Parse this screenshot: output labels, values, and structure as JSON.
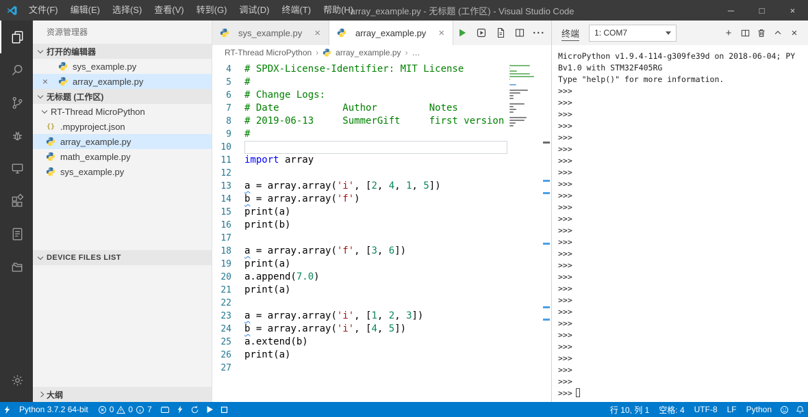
{
  "window": {
    "title": "array_example.py - 无标题 (工作区) - Visual Studio Code",
    "menus": [
      "文件(F)",
      "编辑(E)",
      "选择(S)",
      "查看(V)",
      "转到(G)",
      "调试(D)",
      "终端(T)",
      "帮助(H)"
    ],
    "controls": {
      "minimize": "─",
      "maximize": "□",
      "close": "×"
    }
  },
  "icons": {
    "more_actions": "···",
    "breadcrumb_separator": "›",
    "tab_close": "×",
    "close_glyph": "×",
    "plus": "+",
    "json_glyph": "{}"
  },
  "activity_bar": {
    "items": [
      "explorer",
      "search",
      "source-control",
      "debug",
      "device",
      "extensions",
      "notes",
      "folders"
    ],
    "bottom_item": "settings"
  },
  "sidebar": {
    "title": "资源管理器",
    "open_editors": {
      "header": "打开的编辑器",
      "items": [
        {
          "label": "sys_example.py",
          "selected": false
        },
        {
          "label": "array_example.py",
          "selected": true
        }
      ]
    },
    "workspace": {
      "header": "无标题 (工作区)",
      "folder": "RT-Thread MicroPython",
      "files": [
        {
          "label": ".mpyproject.json",
          "icon": "json",
          "selected": false
        },
        {
          "label": "array_example.py",
          "icon": "python",
          "selected": true
        },
        {
          "label": "math_example.py",
          "icon": "python",
          "selected": false
        },
        {
          "label": "sys_example.py",
          "icon": "python",
          "selected": false
        }
      ]
    },
    "device_files_header": "DEVICE FILES LIST",
    "outline_header": "大纲"
  },
  "editor": {
    "tabs": [
      {
        "label": "sys_example.py",
        "active": false
      },
      {
        "label": "array_example.py",
        "active": true
      }
    ],
    "breadcrumbs": [
      "RT-Thread MicroPython",
      "array_example.py",
      "…"
    ],
    "current_line": 10,
    "lines": [
      {
        "n": 4,
        "t": [
          [
            "c",
            "# SPDX-License-Identifier: MIT License"
          ]
        ]
      },
      {
        "n": 5,
        "t": [
          [
            "c",
            "#"
          ]
        ]
      },
      {
        "n": 6,
        "t": [
          [
            "c",
            "# Change Logs:"
          ]
        ]
      },
      {
        "n": 7,
        "t": [
          [
            "c",
            "# Date           Author         Notes"
          ]
        ]
      },
      {
        "n": 8,
        "t": [
          [
            "c",
            "# 2019-06-13     SummerGift     first version"
          ]
        ]
      },
      {
        "n": 9,
        "t": [
          [
            "c",
            "#"
          ]
        ]
      },
      {
        "n": 10,
        "t": []
      },
      {
        "n": 11,
        "t": [
          [
            "k",
            "import"
          ],
          [
            "d",
            " array"
          ]
        ]
      },
      {
        "n": 12,
        "t": []
      },
      {
        "n": 13,
        "t": [
          [
            "du",
            "a"
          ],
          [
            "d",
            " = array.array("
          ],
          [
            "s",
            "'i'"
          ],
          [
            "d",
            ", ["
          ],
          [
            "n",
            "2"
          ],
          [
            "d",
            ", "
          ],
          [
            "n",
            "4"
          ],
          [
            "d",
            ", "
          ],
          [
            "n",
            "1"
          ],
          [
            "d",
            ", "
          ],
          [
            "n",
            "5"
          ],
          [
            "d",
            "])"
          ]
        ]
      },
      {
        "n": 14,
        "t": [
          [
            "du",
            "b"
          ],
          [
            "d",
            " = array.array("
          ],
          [
            "s",
            "'f'"
          ],
          [
            "d",
            ")"
          ]
        ]
      },
      {
        "n": 15,
        "t": [
          [
            "d",
            "print(a)"
          ]
        ]
      },
      {
        "n": 16,
        "t": [
          [
            "d",
            "print(b)"
          ]
        ]
      },
      {
        "n": 17,
        "t": []
      },
      {
        "n": 18,
        "t": [
          [
            "du",
            "a"
          ],
          [
            "d",
            " = array.array("
          ],
          [
            "s",
            "'f'"
          ],
          [
            "d",
            ", ["
          ],
          [
            "n",
            "3"
          ],
          [
            "d",
            ", "
          ],
          [
            "n",
            "6"
          ],
          [
            "d",
            "])"
          ]
        ]
      },
      {
        "n": 19,
        "t": [
          [
            "d",
            "print(a)"
          ]
        ]
      },
      {
        "n": 20,
        "t": [
          [
            "d",
            "a.append("
          ],
          [
            "n",
            "7.0"
          ],
          [
            "d",
            ")"
          ]
        ]
      },
      {
        "n": 21,
        "t": [
          [
            "d",
            "print(a)"
          ]
        ]
      },
      {
        "n": 22,
        "t": []
      },
      {
        "n": 23,
        "t": [
          [
            "du",
            "a"
          ],
          [
            "d",
            " = array.array("
          ],
          [
            "s",
            "'i'"
          ],
          [
            "d",
            ", ["
          ],
          [
            "n",
            "1"
          ],
          [
            "d",
            ", "
          ],
          [
            "n",
            "2"
          ],
          [
            "d",
            ", "
          ],
          [
            "n",
            "3"
          ],
          [
            "d",
            "])"
          ]
        ]
      },
      {
        "n": 24,
        "t": [
          [
            "du",
            "b"
          ],
          [
            "d",
            " = array.array("
          ],
          [
            "s",
            "'i'"
          ],
          [
            "d",
            ", ["
          ],
          [
            "n",
            "4"
          ],
          [
            "d",
            ", "
          ],
          [
            "n",
            "5"
          ],
          [
            "d",
            "])"
          ]
        ]
      },
      {
        "n": 25,
        "t": [
          [
            "d",
            "a.extend(b)"
          ]
        ]
      },
      {
        "n": 26,
        "t": [
          [
            "d",
            "print(a)"
          ]
        ]
      },
      {
        "n": 27,
        "t": []
      }
    ]
  },
  "terminal": {
    "title": "终端",
    "selected_device": "1: COM7",
    "intro_lines": [
      "MicroPython v1.9.4-114-g309fe39d on 2018-06-04; PY",
      "Bv1.0 with STM32F405RG",
      "Type \"help()\" for more information."
    ],
    "prompt": ">>>",
    "prompt_count": 27
  },
  "status_bar": {
    "interpreter": "Python 3.7.2 64-bit",
    "errors": "0",
    "warnings": "0",
    "infos": "7",
    "line_col": "行 10, 列 1",
    "indent": "空格: 4",
    "encoding": "UTF-8",
    "eol": "LF",
    "language": "Python"
  },
  "colors": {
    "accent": "#007acc",
    "titlebar": "#3b3b3b",
    "activitybar": "#333333",
    "sidebar": "#f3f3f3",
    "selection": "#d6ebff",
    "comment": "#008000",
    "keyword": "#0000ff",
    "string": "#a31515",
    "number": "#098658",
    "run_green": "#3fa33f"
  }
}
